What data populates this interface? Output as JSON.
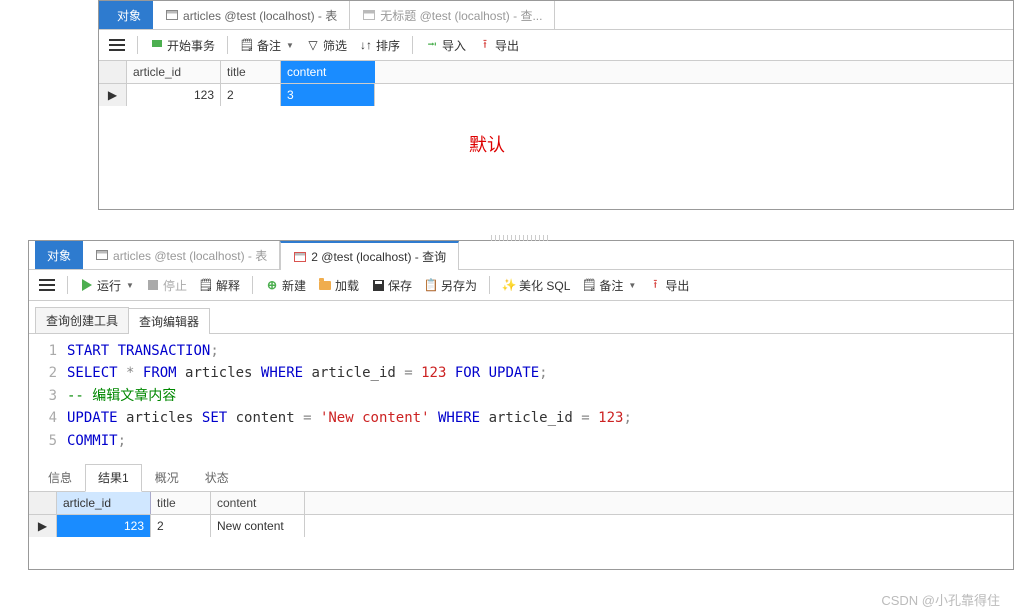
{
  "panel1": {
    "tabs": {
      "object": "对象",
      "articles": "articles @test (localhost) - 表",
      "untitled": "无标题 @test (localhost) - 查..."
    },
    "toolbar": {
      "begin_tx": "开始事务",
      "memo": "备注",
      "filter": "筛选",
      "sort": "排序",
      "import": "导入",
      "export": "导出"
    },
    "grid": {
      "headers": {
        "article_id": "article_id",
        "title": "title",
        "content": "content"
      },
      "row": {
        "article_id": "123",
        "title": "2",
        "content": "3"
      }
    },
    "annotation": "默认"
  },
  "panel2": {
    "tabs": {
      "object": "对象",
      "articles": "articles @test (localhost) - 表",
      "query2": "2 @test (localhost) - 查询"
    },
    "toolbar": {
      "run": "运行",
      "stop": "停止",
      "explain": "解释",
      "new": "新建",
      "load": "加载",
      "save": "保存",
      "saveas": "另存为",
      "beautify": "美化 SQL",
      "memo": "备注",
      "export": "导出"
    },
    "subtabs": {
      "builder": "查询创建工具",
      "editor": "查询编辑器"
    },
    "sql": {
      "line1": {
        "n": "1",
        "tokens": {
          "t1": "START",
          "t2": "TRANSACTION",
          "p": ";"
        }
      },
      "line2": {
        "n": "2",
        "tokens": {
          "t1": "SELECT",
          "t2": "*",
          "t3": "FROM",
          "t4": "articles",
          "t5": "WHERE",
          "t6": "article_id",
          "t7": "=",
          "t8": "123",
          "t9": "FOR",
          "t10": "UPDATE",
          "p": ";"
        }
      },
      "line3": {
        "n": "3",
        "comment": "-- 编辑文章内容"
      },
      "line4": {
        "n": "4",
        "tokens": {
          "t1": "UPDATE",
          "t2": "articles",
          "t3": "SET",
          "t4": "content",
          "t5": "=",
          "t6": "'New content'",
          "t7": "WHERE",
          "t8": "article_id",
          "t9": "=",
          "t10": "123",
          "p": ";"
        }
      },
      "line5": {
        "n": "5",
        "tokens": {
          "t1": "COMMIT",
          "p": ";"
        }
      }
    },
    "result_tabs": {
      "info": "信息",
      "result1": "结果1",
      "profile": "概况",
      "status": "状态"
    },
    "result_grid": {
      "headers": {
        "article_id": "article_id",
        "title": "title",
        "content": "content"
      },
      "row": {
        "article_id": "123",
        "title": "2",
        "content": "New content"
      }
    }
  },
  "watermark": "CSDN @小孔靠得住"
}
